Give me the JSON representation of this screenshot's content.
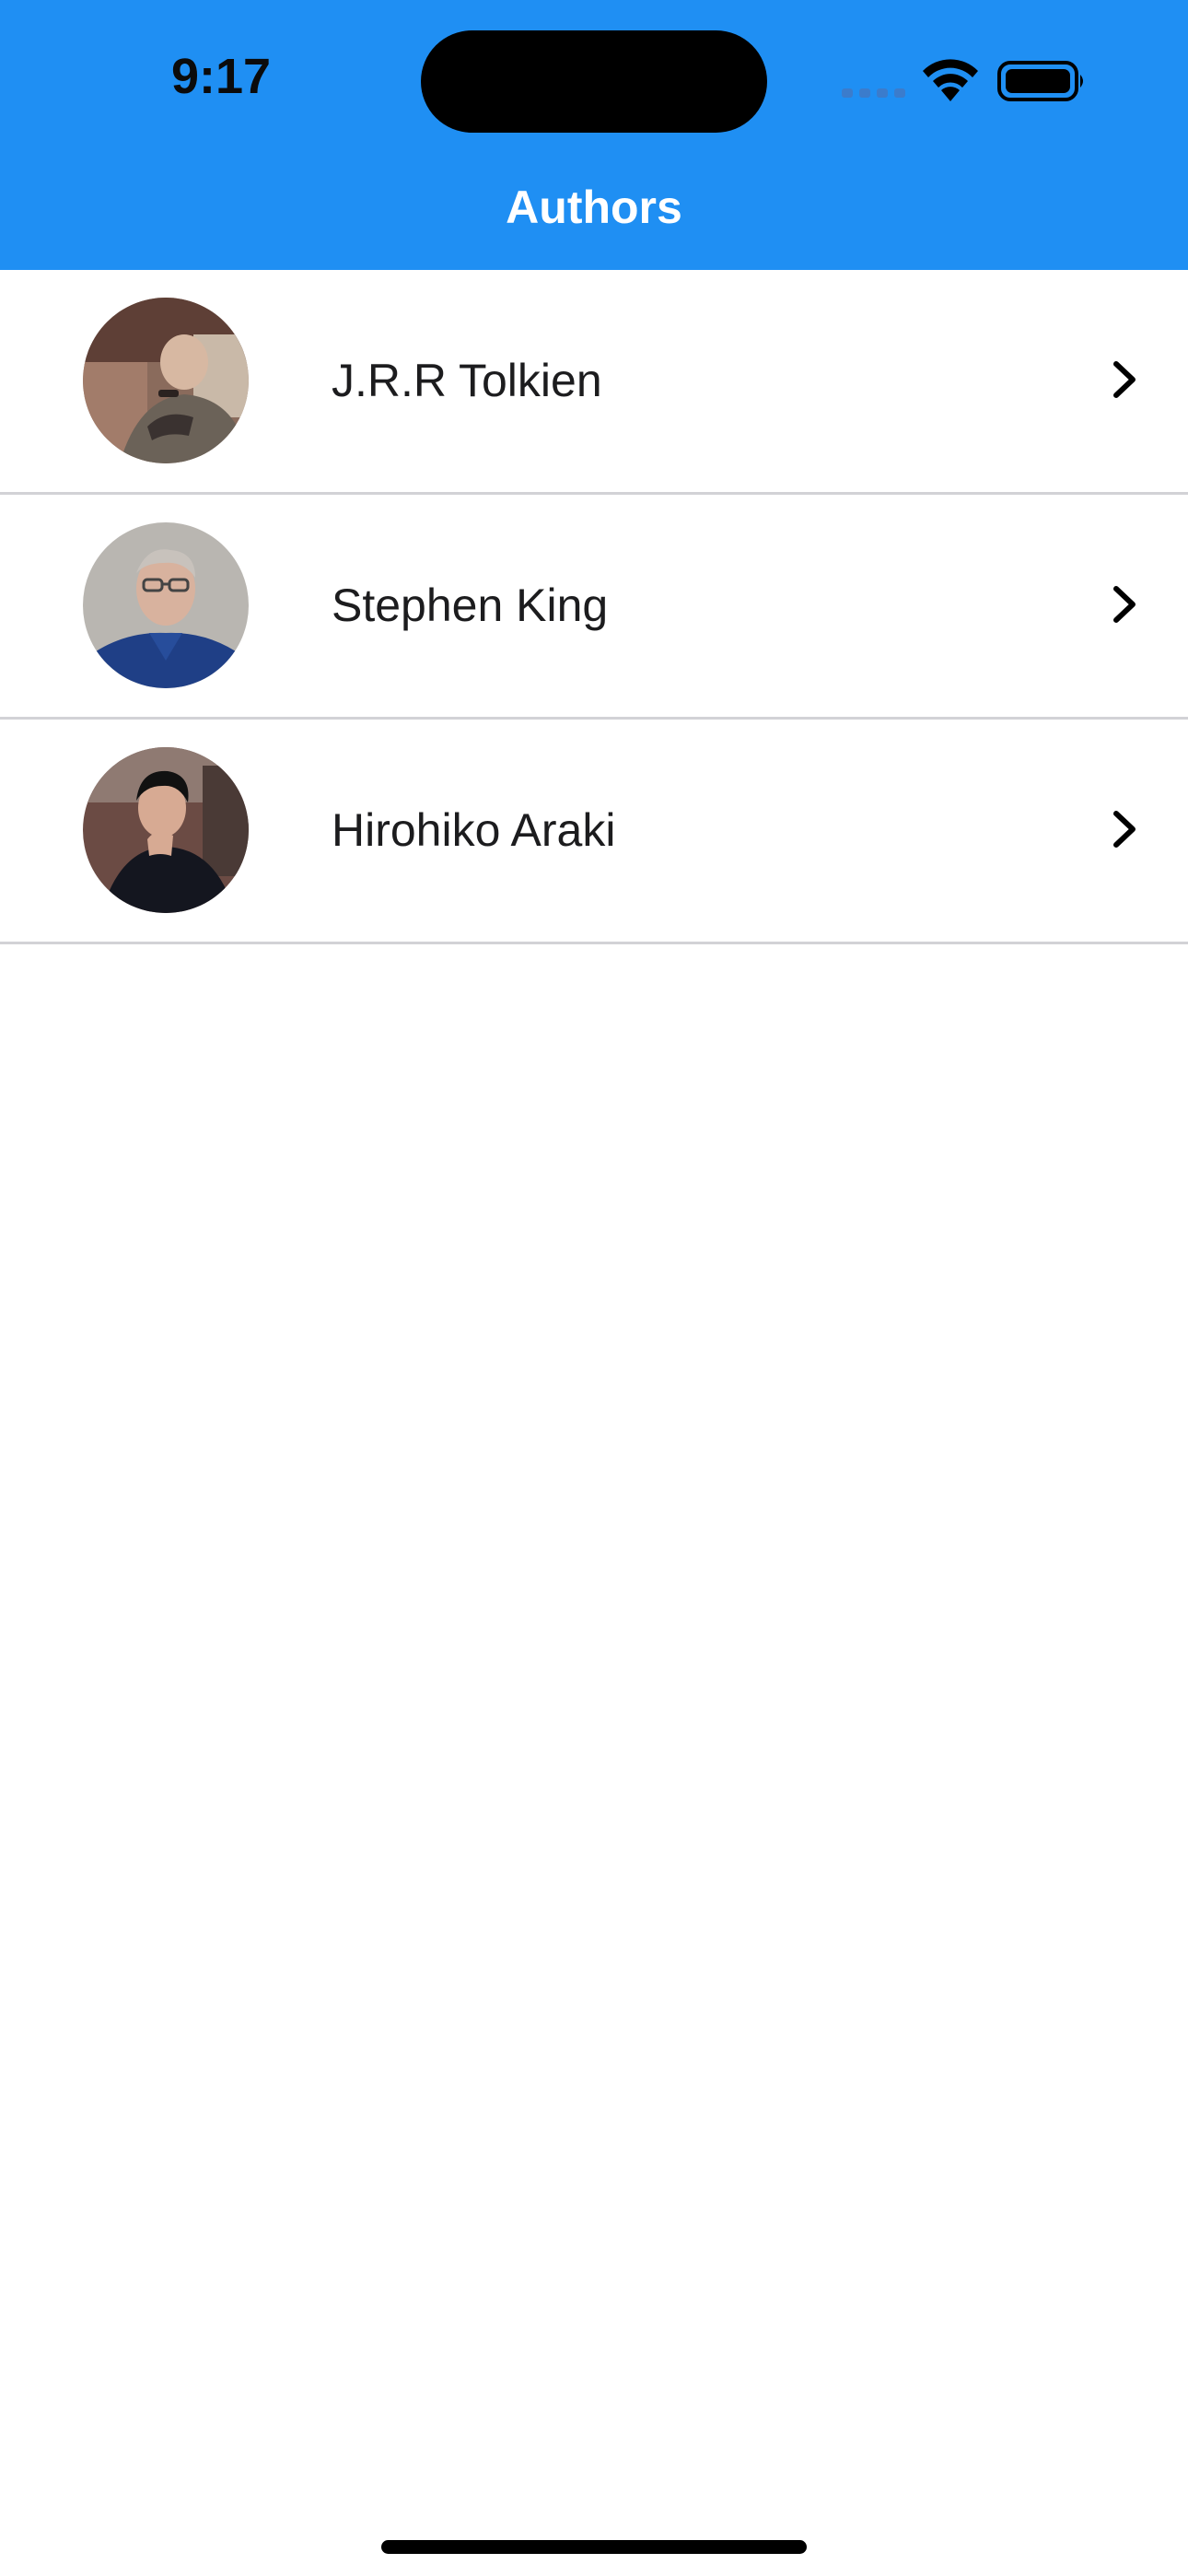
{
  "status_bar": {
    "time": "9:17"
  },
  "nav": {
    "title": "Authors"
  },
  "colors": {
    "header_background": "#1f8ff3",
    "row_separator": "#d2d2d6",
    "title_text": "#ffffff"
  },
  "authors": [
    {
      "name": "J.R.R Tolkien",
      "icon": "chevron-right-icon"
    },
    {
      "name": "Stephen King",
      "icon": "chevron-right-icon"
    },
    {
      "name": "Hirohiko Araki",
      "icon": "chevron-right-icon"
    }
  ]
}
